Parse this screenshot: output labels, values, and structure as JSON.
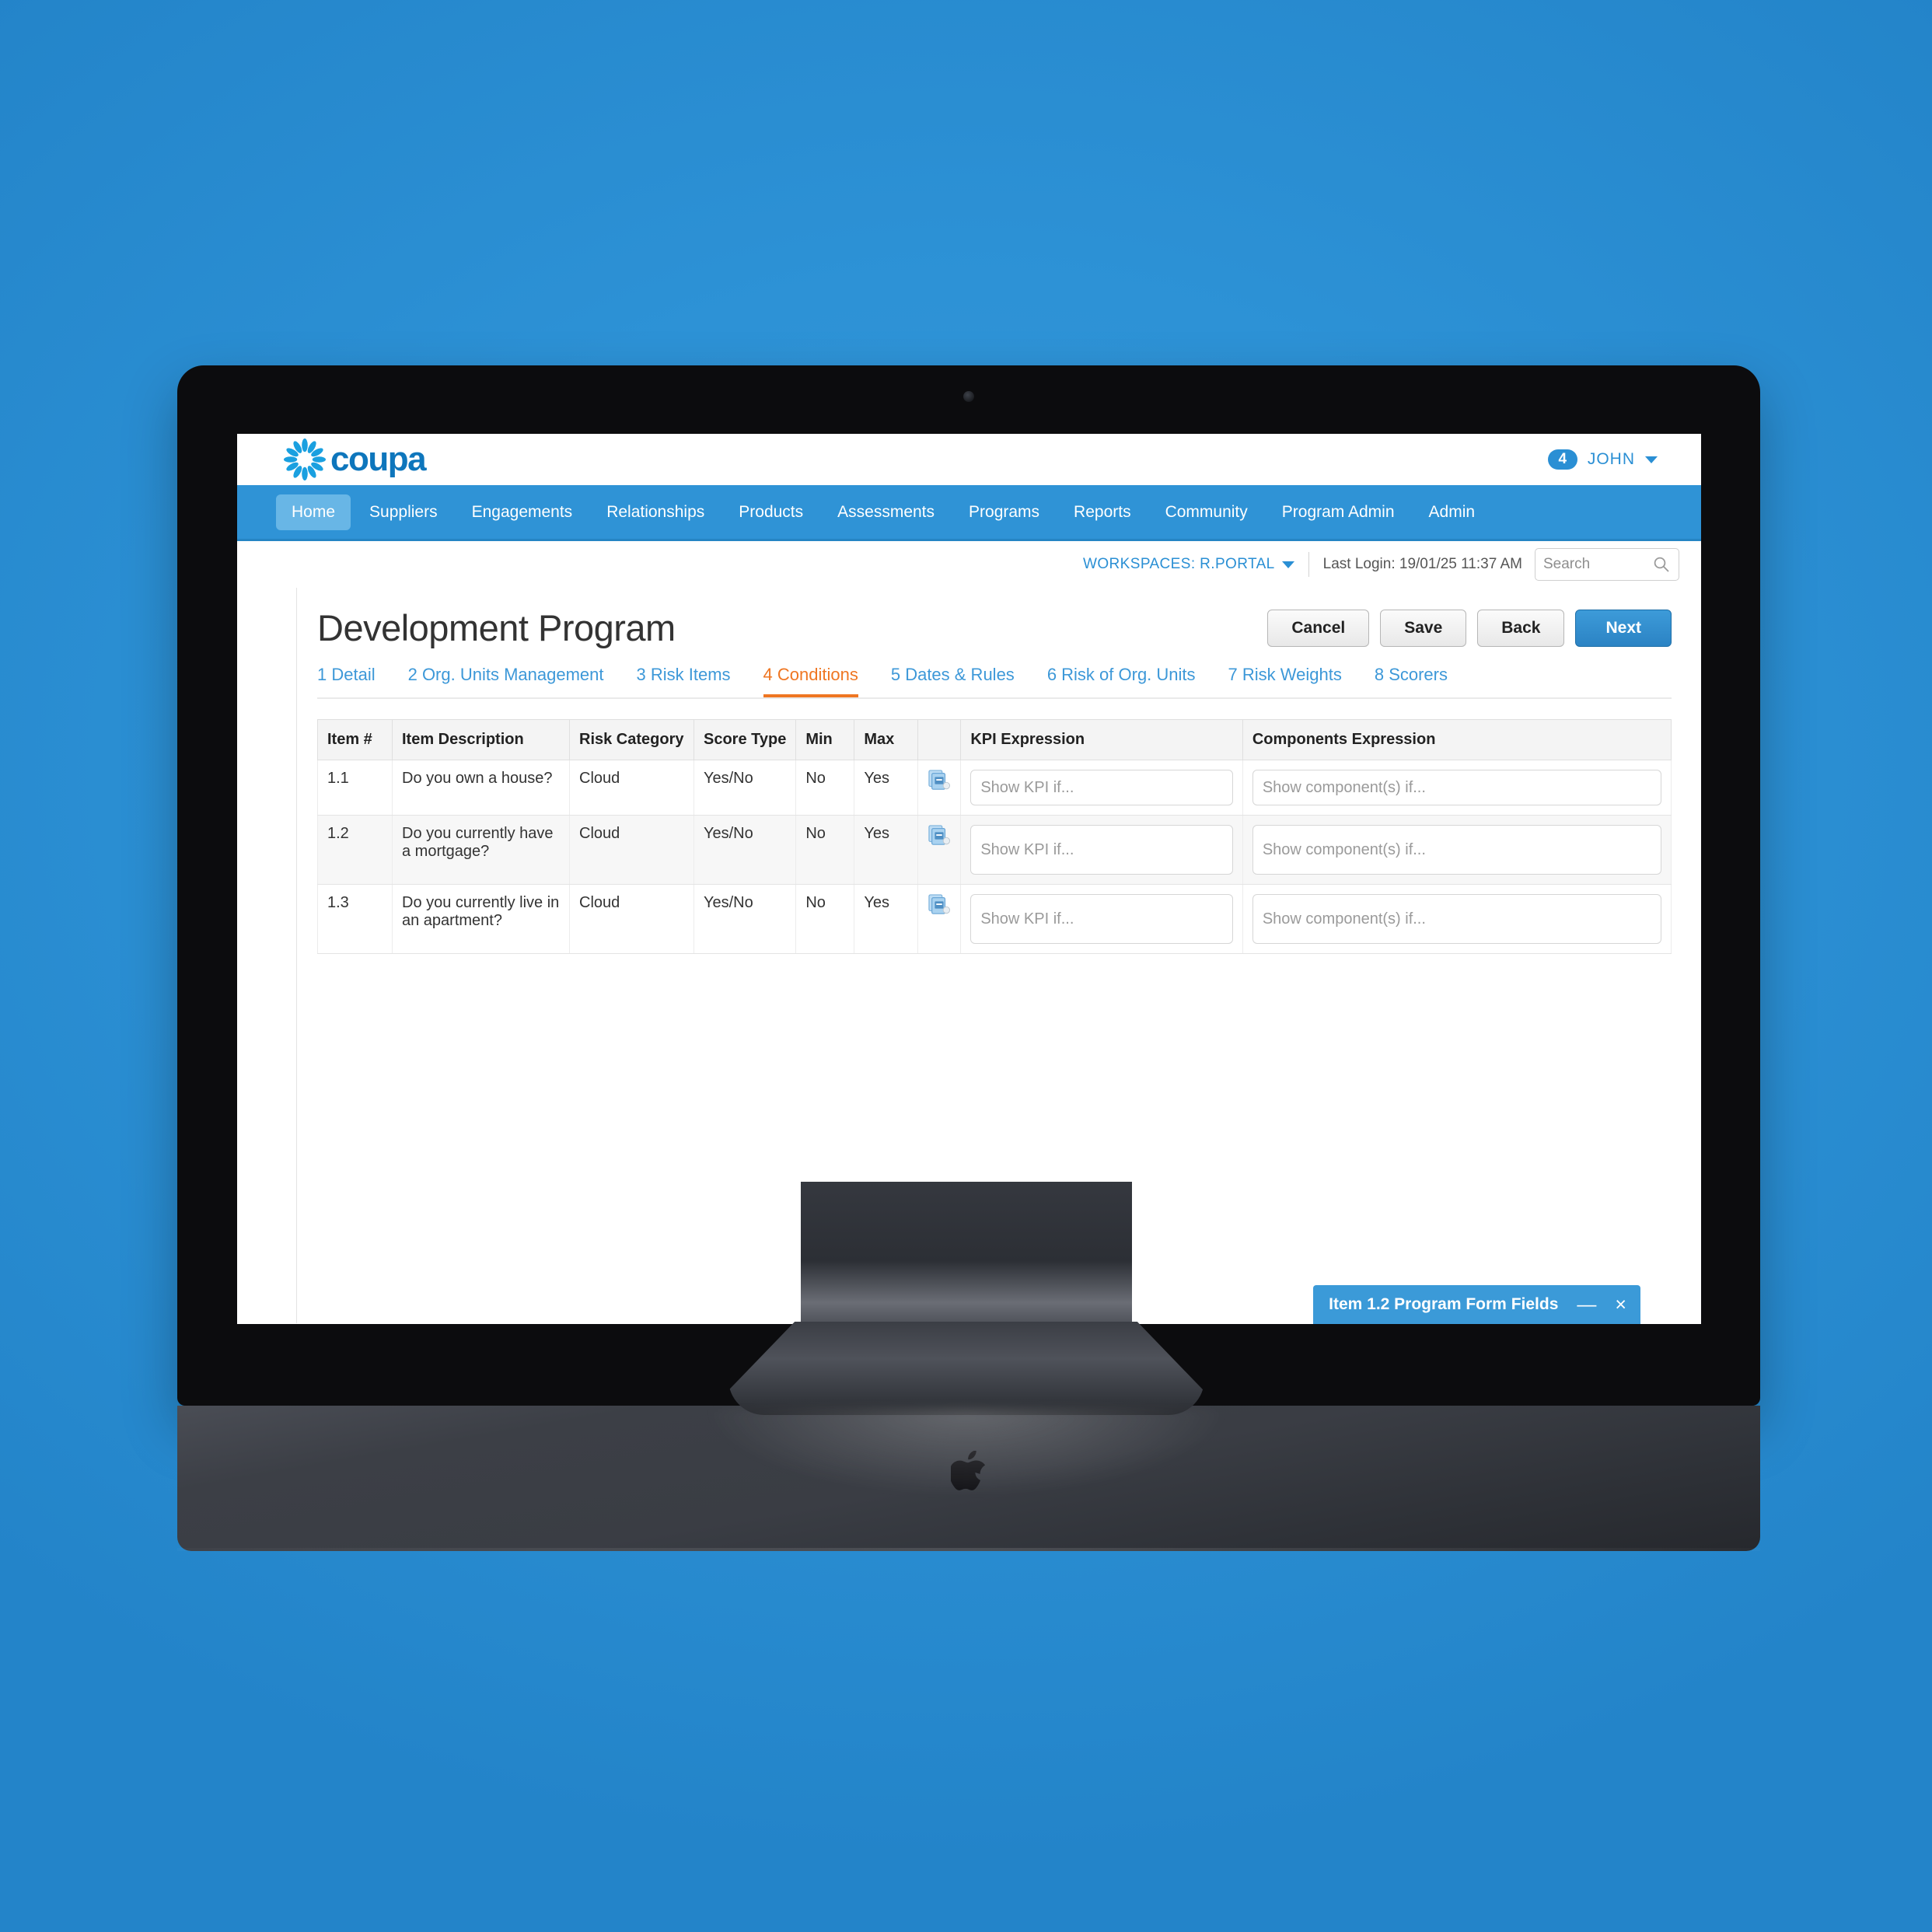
{
  "brand": {
    "name": "coupa",
    "logo_icon": "coupa-flower-icon",
    "accent": "#0e76bc"
  },
  "header": {
    "notification_count": "4",
    "user_name": "JOHN",
    "user_caret_icon": "chevron-down-icon"
  },
  "nav": {
    "items": [
      {
        "label": "Home",
        "active": true
      },
      {
        "label": "Suppliers",
        "active": false
      },
      {
        "label": "Engagements",
        "active": false
      },
      {
        "label": "Relationships",
        "active": false
      },
      {
        "label": "Products",
        "active": false
      },
      {
        "label": "Assessments",
        "active": false
      },
      {
        "label": "Programs",
        "active": false
      },
      {
        "label": "Reports",
        "active": false
      },
      {
        "label": "Community",
        "active": false
      },
      {
        "label": "Program Admin",
        "active": false
      },
      {
        "label": "Admin",
        "active": false
      }
    ],
    "bar_color": "#2f93d6",
    "active_color": "#68b6e6"
  },
  "subbar": {
    "workspaces_label": "WORKSPACES: R.PORTAL",
    "workspaces_caret_icon": "chevron-down-icon",
    "last_login": "Last Login: 19/01/25 11:37 AM",
    "search_placeholder": "Search",
    "search_value": "",
    "search_icon": "magnifier-icon"
  },
  "page": {
    "title": "Development Program",
    "buttons": {
      "cancel": "Cancel",
      "save": "Save",
      "back": "Back",
      "next": "Next"
    },
    "primary_color": "#2b83c4"
  },
  "steps": {
    "active_color": "#ef7622",
    "items": [
      {
        "label": "1 Detail",
        "current": false
      },
      {
        "label": "2 Org. Units Management",
        "current": false
      },
      {
        "label": "3 Risk Items",
        "current": false
      },
      {
        "label": "4 Conditions",
        "current": true
      },
      {
        "label": "5 Dates & Rules",
        "current": false
      },
      {
        "label": "6 Risk of Org. Units",
        "current": false
      },
      {
        "label": "7 Risk Weights",
        "current": false
      },
      {
        "label": "8 Scorers",
        "current": false
      }
    ]
  },
  "table": {
    "columns": [
      "Item #",
      "Item Description",
      "Risk Category",
      "Score Type",
      "Min",
      "Max",
      "",
      "KPI Expression",
      "Components Expression"
    ],
    "rows": [
      {
        "item": "1.1",
        "description": "Do you own a house?",
        "risk_category": "Cloud",
        "score_type": "Yes/No",
        "min": "No",
        "max": "Yes",
        "icon": "documents-copy-icon",
        "kpi_placeholder": "Show KPI if...",
        "kpi_value": "",
        "components_placeholder": "Show component(s) if...",
        "components_value": ""
      },
      {
        "item": "1.2",
        "description": "Do you currently have a mortgage?",
        "risk_category": "Cloud",
        "score_type": "Yes/No",
        "min": "No",
        "max": "Yes",
        "icon": "documents-copy-icon",
        "kpi_placeholder": "Show KPI if...",
        "kpi_value": "",
        "components_placeholder": "Show component(s) if...",
        "components_value": ""
      },
      {
        "item": "1.3",
        "description": "Do you currently live in an apartment?",
        "risk_category": "Cloud",
        "score_type": "Yes/No",
        "min": "No",
        "max": "Yes",
        "icon": "documents-copy-icon",
        "kpi_placeholder": "Show KPI if...",
        "kpi_value": "",
        "components_placeholder": "Show component(s) if...",
        "components_value": ""
      }
    ]
  },
  "dock_panel": {
    "title": "Item 1.2 Program Form Fields",
    "minimize_label": "—",
    "close_label": "×",
    "minimize_icon": "minimize-icon",
    "close_icon": "close-icon",
    "background": "#3b9ad8"
  },
  "device": {
    "brand_logo_icon": "apple-logo-icon",
    "camera_icon": "camera-icon"
  }
}
